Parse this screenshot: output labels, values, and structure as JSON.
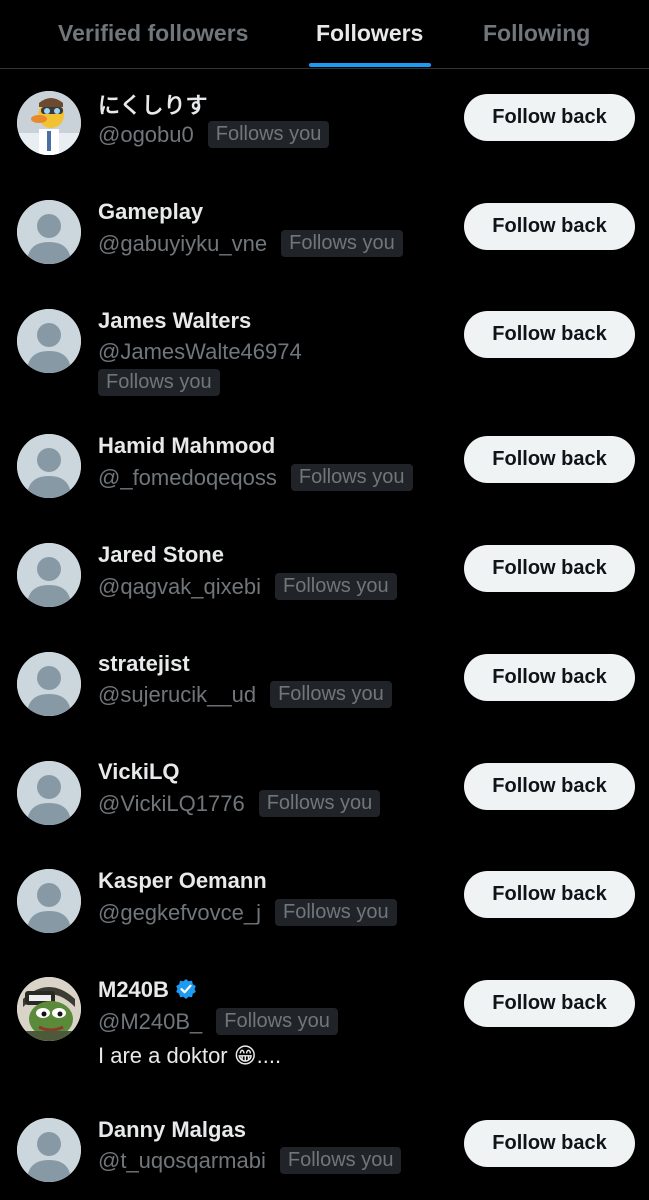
{
  "tabs": [
    {
      "label": "Verified followers",
      "active": false
    },
    {
      "label": "Followers",
      "active": true
    },
    {
      "label": "Following",
      "active": false
    }
  ],
  "colors": {
    "background": "#000000",
    "accent": "#1d9bf0",
    "muted_text": "#71767b",
    "badge_bg": "#202327",
    "button_bg": "#eff3f4"
  },
  "users": [
    {
      "name": "にくしりす",
      "handle": "@ogobu0",
      "badge": "Follows you",
      "button": "Follow back",
      "avatar": "custom-duck-avatar"
    },
    {
      "name": "Gameplay",
      "handle": "@gabuyiyku_vne",
      "badge": "Follows you",
      "button": "Follow back",
      "avatar": "default-avatar"
    },
    {
      "name": "James Walters",
      "handle": "@JamesWalte46974",
      "badge": "Follows you",
      "button": "Follow back",
      "avatar": "default-avatar"
    },
    {
      "name": "Hamid Mahmood",
      "handle": "@_fomedoqeqoss",
      "badge": "Follows you",
      "button": "Follow back",
      "avatar": "default-avatar"
    },
    {
      "name": "Jared Stone",
      "handle": "@qagvak_qixebi",
      "badge": "Follows you",
      "button": "Follow back",
      "avatar": "default-avatar"
    },
    {
      "name": "stratejist",
      "handle": "@sujerucik__ud",
      "badge": "Follows you",
      "button": "Follow back",
      "avatar": "default-avatar"
    },
    {
      "name": "VickiLQ",
      "handle": "@VickiLQ1776",
      "badge": "Follows you",
      "button": "Follow back",
      "avatar": "default-avatar"
    },
    {
      "name": "Kasper Oemann",
      "handle": "@gegkefvovce_j",
      "badge": "Follows you",
      "button": "Follow back",
      "avatar": "default-avatar"
    },
    {
      "name": "M240B",
      "handle": "@M240B_",
      "badge": "Follows you",
      "button": "Follow back",
      "avatar": "custom-frog-avatar",
      "verified": true,
      "bio": "I are a doktor 😁...."
    },
    {
      "name": "Danny Malgas",
      "handle": "@t_uqosqarmabi",
      "badge": "Follows you",
      "button": "Follow back",
      "avatar": "default-avatar"
    }
  ]
}
